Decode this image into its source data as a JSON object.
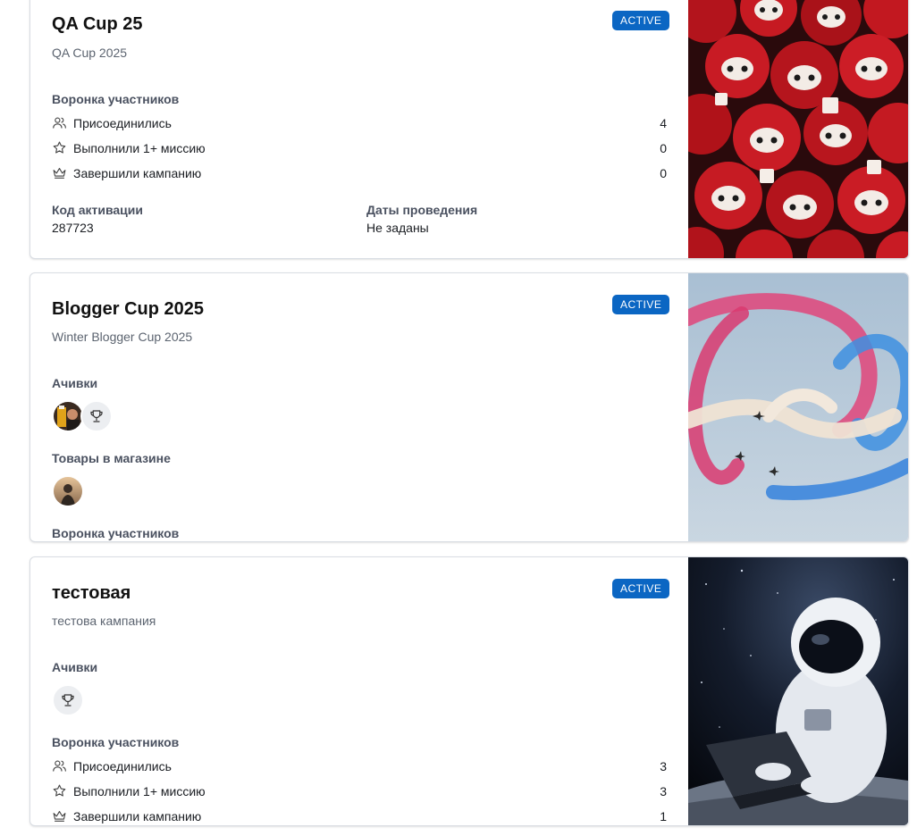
{
  "cards": [
    {
      "title": "QA Cup 25",
      "subtitle": "QA Cup 2025",
      "status": "ACTIVE",
      "funnel_label": "Воронка участников",
      "funnel": [
        {
          "icon": "users-icon",
          "label": "Присоединились",
          "value": "4"
        },
        {
          "icon": "star-icon",
          "label": "Выполнили 1+ миссию",
          "value": "0"
        },
        {
          "icon": "crown-icon",
          "label": "Завершили кампанию",
          "value": "0"
        }
      ],
      "activation_code_label": "Код активации",
      "activation_code": "287723",
      "dates_label": "Даты проведения",
      "dates_value": "Не заданы",
      "image": "daruma-dolls-image"
    },
    {
      "title": "Blogger Cup 2025",
      "subtitle": "Winter Blogger Cup 2025",
      "status": "ACTIVE",
      "achievements_label": "Ачивки",
      "shop_label": "Товары в магазине",
      "funnel_label": "Воронка участников",
      "image": "air-show-smoke-image"
    },
    {
      "title": "тестовая",
      "subtitle": "тестова кампания",
      "status": "ACTIVE",
      "achievements_label": "Ачивки",
      "funnel_label": "Воронка участников",
      "funnel": [
        {
          "icon": "users-icon",
          "label": "Присоединились",
          "value": "3"
        },
        {
          "icon": "star-icon",
          "label": "Выполнили 1+ миссию",
          "value": "3"
        },
        {
          "icon": "crown-icon",
          "label": "Завершили кампанию",
          "value": "1"
        }
      ],
      "image": "astronaut-laptop-image"
    }
  ],
  "colors": {
    "badge": "#0b66c3",
    "card_border": "#d9dde3",
    "muted_text": "#5c6470"
  }
}
